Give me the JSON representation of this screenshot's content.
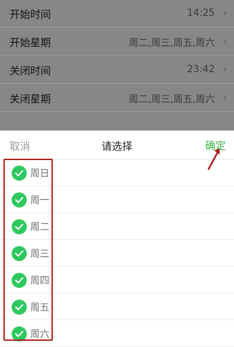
{
  "settings": {
    "rows": [
      {
        "label": "开始时间",
        "value": "14:25"
      },
      {
        "label": "开始星期",
        "value": "周二,周三,周五,周六"
      },
      {
        "label": "关闭时间",
        "value": "23:42"
      },
      {
        "label": "关闭星期",
        "value": "周二,周三,周五,周六"
      }
    ],
    "chevron": "›"
  },
  "picker": {
    "cancel_label": "取消",
    "title": "请选择",
    "confirm_label": "确定",
    "options": [
      {
        "label": "周日",
        "checked": true
      },
      {
        "label": "周一",
        "checked": true
      },
      {
        "label": "周二",
        "checked": true
      },
      {
        "label": "周三",
        "checked": true
      },
      {
        "label": "周四",
        "checked": true
      },
      {
        "label": "周五",
        "checked": true
      },
      {
        "label": "周六",
        "checked": true
      }
    ],
    "check_color": "#2dc95e",
    "confirm_color": "#39b54a"
  },
  "annotation": {
    "highlight_color": "#b21f1f",
    "arrow_color": "#b21f1f"
  }
}
